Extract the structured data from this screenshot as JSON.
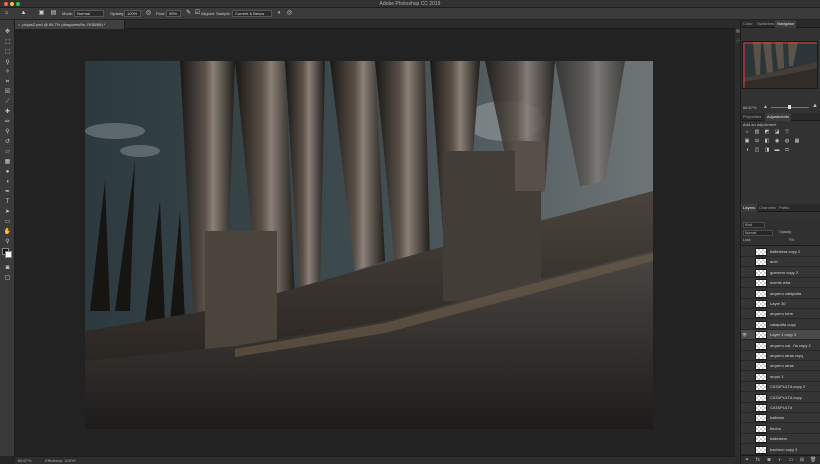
{
  "app": {
    "title": "Adobe Photoshop CC 2019"
  },
  "options_bar": {
    "mode_label": "Mode:",
    "mode_value": "Normal",
    "opacity_label": "Opacity:",
    "opacity_value": "100%",
    "flow_label": "Flow:",
    "flow_value": "95%",
    "aligned_label": "Aligned",
    "sample_label": "Sample:",
    "sample_value": "Current & Below"
  },
  "document": {
    "tab_title": "pinjas2.psd @ 66.7% (dragones/ño, RGB/8#) *",
    "zoom": "66.67%",
    "efficiency": "Efficiency: 100%*"
  },
  "right_panels": {
    "top_tabs": [
      "Color",
      "Swatches",
      "Navigator"
    ],
    "active_top_tab": "Navigator",
    "navigator_zoom": "66.67%",
    "mid_tabs": [
      "Properties",
      "Adjustments"
    ],
    "active_mid_tab": "Adjustments",
    "add_adjustment_label": "Add an adjustment",
    "layer_tabs": [
      "Layers",
      "Channels",
      "Paths"
    ],
    "active_layer_tab": "Layers",
    "kind_label": "Kind",
    "blend_mode": "Normal",
    "opacity": "Opacity:",
    "lock_label": "Lock:",
    "fill": "Fill:"
  },
  "layers": [
    {
      "name": "ballestera copy 2",
      "visible": false,
      "selected": false
    },
    {
      "name": "arch",
      "visible": false,
      "selected": false
    },
    {
      "name": "guerrero copy 2",
      "visible": false,
      "selected": false
    },
    {
      "name": "worms wha",
      "visible": false,
      "selected": false
    },
    {
      "name": "arquero catapulta",
      "visible": false,
      "selected": false
    },
    {
      "name": "Layer 30",
      "visible": false,
      "selected": false
    },
    {
      "name": "arquero torre",
      "visible": false,
      "selected": false
    },
    {
      "name": "catapulta copy",
      "visible": false,
      "selected": false
    },
    {
      "name": "Layer 1 copy 3",
      "visible": true,
      "selected": true
    },
    {
      "name": "arquero cai...ña copy 2",
      "visible": false,
      "selected": false
    },
    {
      "name": "arquero atras copy",
      "visible": false,
      "selected": false
    },
    {
      "name": "arquero atras",
      "visible": false,
      "selected": false
    },
    {
      "name": "arquo 1",
      "visible": false,
      "selected": false
    },
    {
      "name": "CATAPULTA copy 2",
      "visible": false,
      "selected": false
    },
    {
      "name": "CATAPULTA copy",
      "visible": false,
      "selected": false
    },
    {
      "name": "CATAPULTA",
      "visible": false,
      "selected": false
    },
    {
      "name": "ballesta",
      "visible": false,
      "selected": false
    },
    {
      "name": "flecha",
      "visible": false,
      "selected": false
    },
    {
      "name": "ballestero",
      "visible": false,
      "selected": false
    },
    {
      "name": "hachero copy 3",
      "visible": false,
      "selected": false
    }
  ],
  "colors": {
    "foreground": "#111111",
    "background": "#ffffff",
    "accent": "#2d8ceb"
  }
}
